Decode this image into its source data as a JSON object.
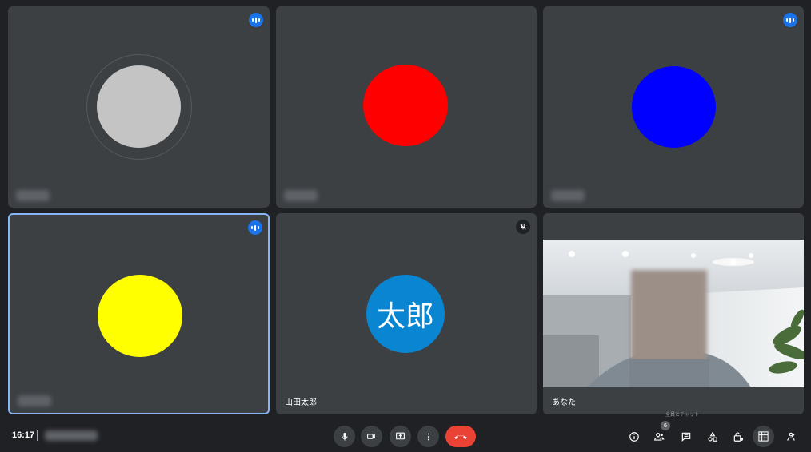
{
  "participants": [
    {
      "name": "",
      "avatar_color": "#c4c4c4",
      "speaking": true
    },
    {
      "name": "",
      "avatar_color": "#ff0000",
      "speaking": false
    },
    {
      "name": "",
      "avatar_color": "#0000ff",
      "speaking": true
    },
    {
      "name": "",
      "avatar_color": "#ffff00",
      "speaking": true,
      "active": true
    },
    {
      "name": "山田太郎",
      "initials": "太郎",
      "avatar_color": "#0a85d1",
      "muted": true
    },
    {
      "name": "あなた",
      "camera_on": true
    }
  ],
  "footer": {
    "time": "16:17",
    "participant_count": "6",
    "tooltip": "全員とチャット"
  },
  "colors": {
    "background": "#202124",
    "tile": "#3c4043",
    "accent": "#1a73e8",
    "hangup": "#ea4335",
    "active_border": "#8ab4f8"
  },
  "controls": {
    "center": [
      "mic-icon",
      "camera-icon",
      "present-screen-icon",
      "more-options-icon",
      "hangup-icon"
    ],
    "right": [
      "info-icon",
      "people-icon",
      "chat-icon",
      "activities-icon",
      "host-controls-icon",
      "layout-grid-icon",
      "self-view-icon"
    ]
  }
}
